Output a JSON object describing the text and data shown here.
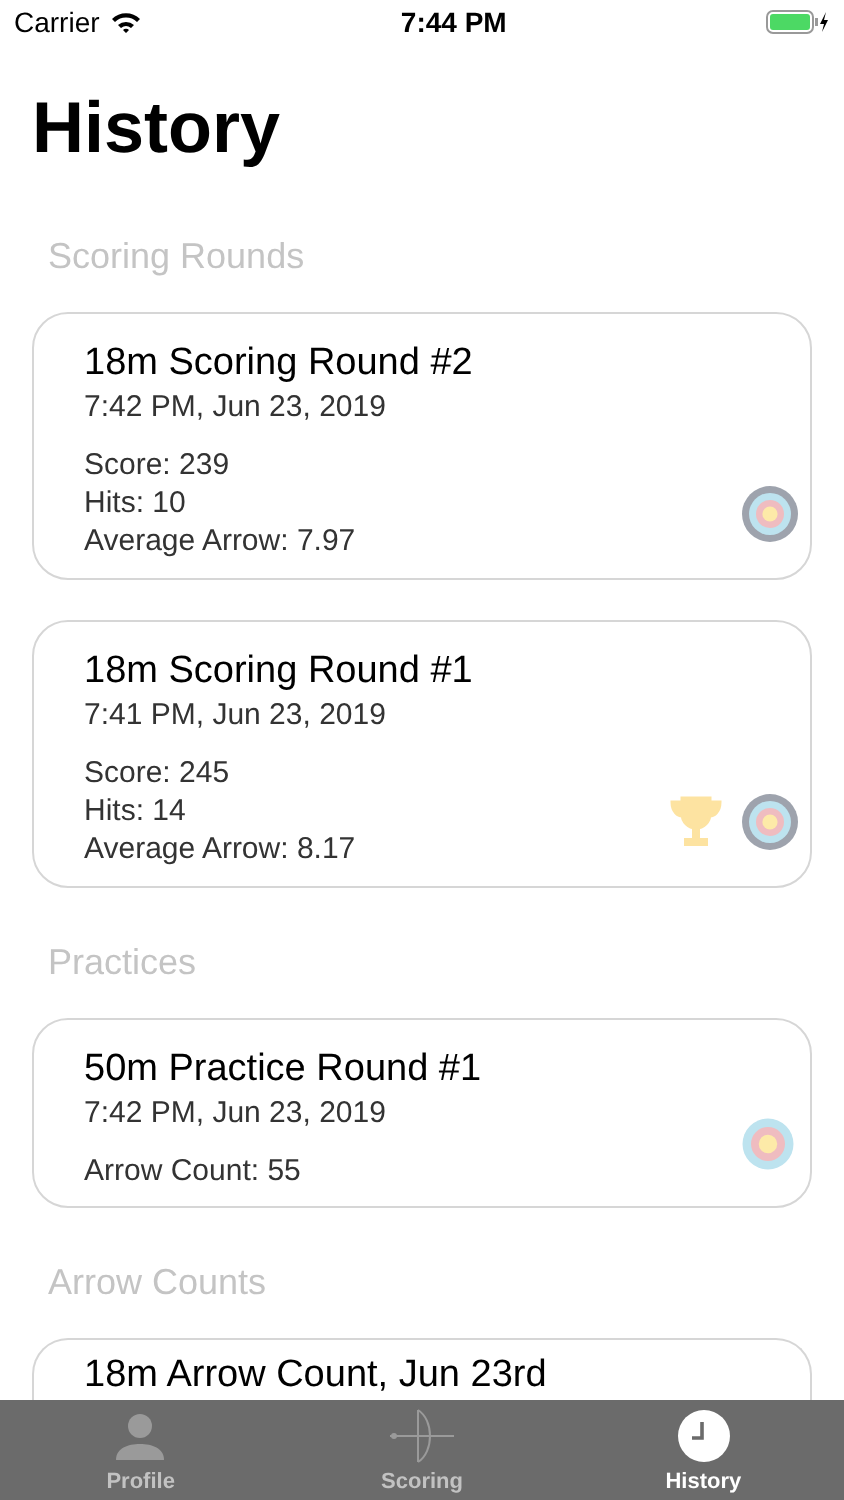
{
  "status_bar": {
    "carrier": "Carrier",
    "time": "7:44 PM"
  },
  "title": "History",
  "sections": [
    {
      "header": "Scoring Rounds",
      "cards": [
        {
          "kind": "scoring",
          "title": "18m Scoring Round #2",
          "date": "7:42 PM, Jun 23, 2019",
          "lines": [
            "Score: 239",
            "Hits: 10",
            "Average Arrow: 7.97"
          ],
          "trophy": false
        },
        {
          "kind": "scoring",
          "title": "18m Scoring Round #1",
          "date": "7:41 PM, Jun 23, 2019",
          "lines": [
            "Score: 245",
            "Hits: 14",
            "Average Arrow: 8.17"
          ],
          "trophy": true
        }
      ]
    },
    {
      "header": "Practices",
      "cards": [
        {
          "kind": "practice",
          "title": "50m Practice Round #1",
          "date": "7:42 PM, Jun 23, 2019",
          "lines": [
            "Arrow Count: 55"
          ],
          "trophy": false
        }
      ]
    },
    {
      "header": "Arrow Counts",
      "cards": [
        {
          "kind": "count",
          "title": "18m Arrow Count, Jun 23rd"
        }
      ]
    }
  ],
  "tabs": [
    {
      "label": "Profile",
      "selected": false
    },
    {
      "label": "Scoring",
      "selected": false
    },
    {
      "label": "History",
      "selected": true
    }
  ]
}
